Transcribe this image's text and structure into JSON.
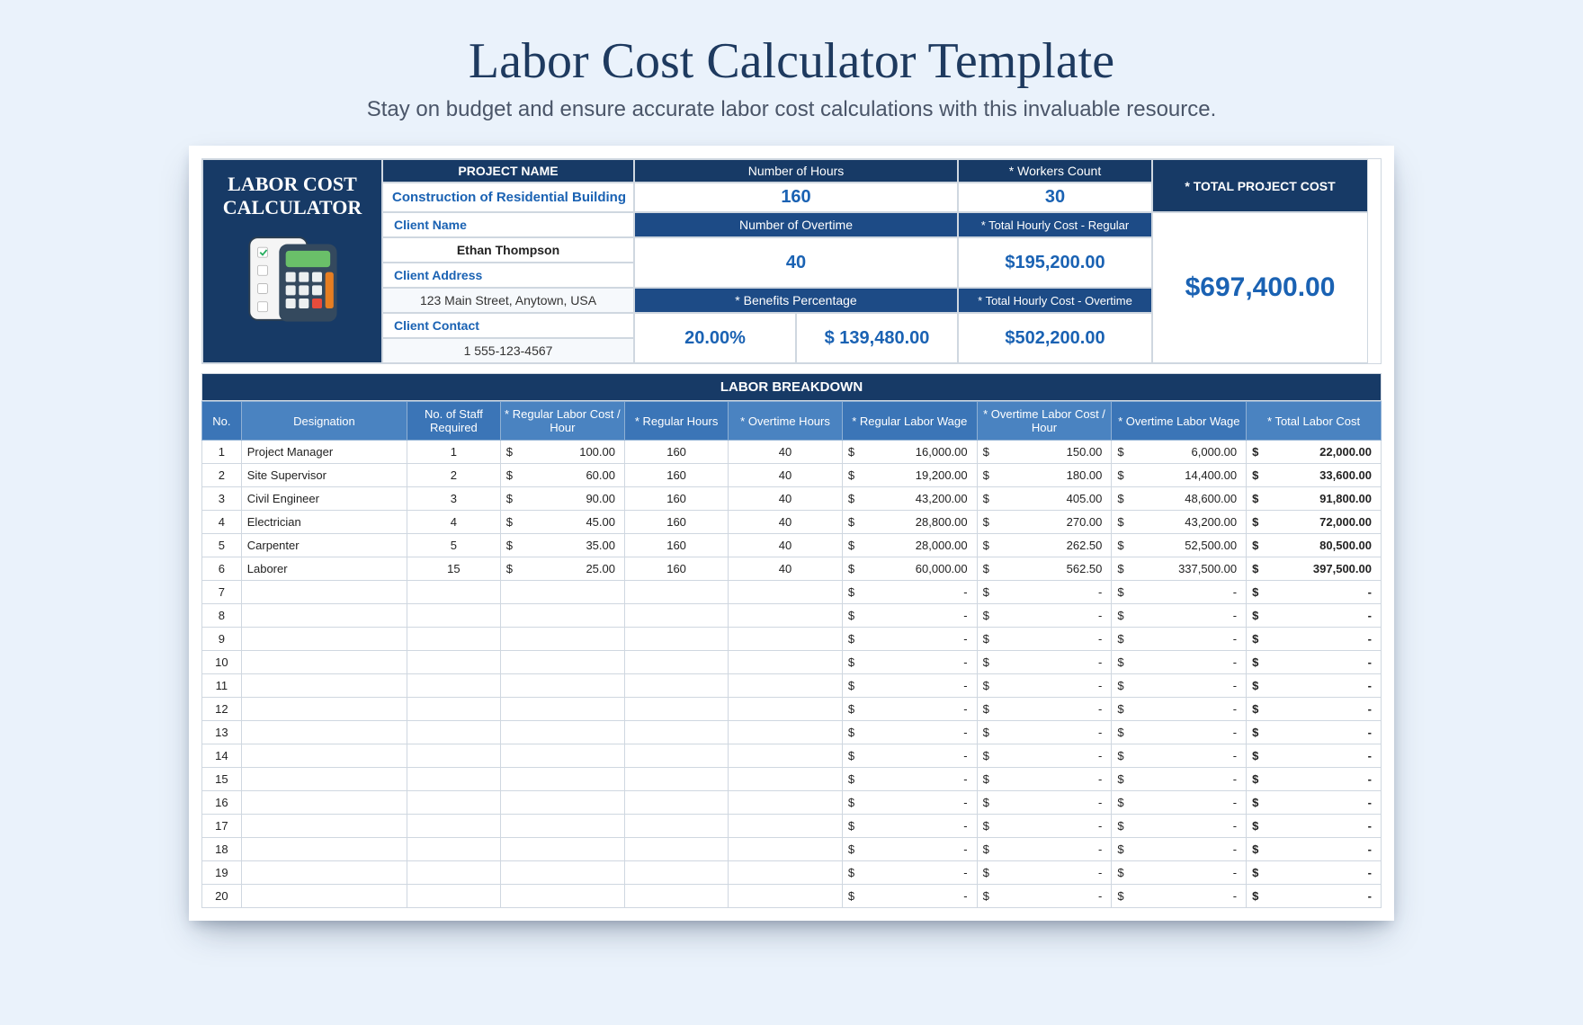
{
  "page": {
    "title": "Labor Cost Calculator Template",
    "subtitle": "Stay on budget and ensure accurate labor cost calculations with this invaluable resource."
  },
  "calc_title_line1": "LABOR COST",
  "calc_title_line2": "CALCULATOR",
  "top": {
    "project_name_label": "PROJECT NAME",
    "project_name_value": "Construction of Residential Building",
    "hours_label": "Number of Hours",
    "hours_value": "160",
    "workers_label": "* Workers Count",
    "workers_value": "30",
    "total_label": "* TOTAL PROJECT COST",
    "total_value": "$697,400.00",
    "client_name_label": "Client Name",
    "client_name_value": "Ethan Thompson",
    "overtime_label": "Number of Overtime",
    "overtime_value": "40",
    "reg_hourly_label": "* Total Hourly Cost - Regular",
    "reg_hourly_value": "$195,200.00",
    "client_addr_label": "Client Address",
    "client_addr_value": "123 Main Street, Anytown, USA",
    "benefits_label": "* Benefits Percentage",
    "benefits_pct": "20.00%",
    "benefits_amt": "$ 139,480.00",
    "ot_hourly_label": "* Total Hourly Cost - Overtime",
    "ot_hourly_value": "$502,200.00",
    "client_contact_label": "Client Contact",
    "client_contact_value": "1 555-123-4567"
  },
  "breakdown_title": "LABOR BREAKDOWN",
  "columns": {
    "no": "No.",
    "designation": "Designation",
    "staff": "No. of Staff Required",
    "rate": "* Regular Labor Cost / Hour",
    "reg_hours": "* Regular Hours",
    "ot_hours": "* Overtime Hours",
    "reg_wage": "* Regular Labor Wage",
    "ot_rate": "* Overtime Labor Cost / Hour",
    "ot_wage": "* Overtime Labor Wage",
    "total": "* Total Labor Cost"
  },
  "rows": [
    {
      "no": 1,
      "designation": "Project Manager",
      "staff": "1",
      "rate": "100.00",
      "rh": "160",
      "oh": "40",
      "rw": "16,000.00",
      "or": "150.00",
      "ow": "6,000.00",
      "tot": "22,000.00"
    },
    {
      "no": 2,
      "designation": "Site Supervisor",
      "staff": "2",
      "rate": "60.00",
      "rh": "160",
      "oh": "40",
      "rw": "19,200.00",
      "or": "180.00",
      "ow": "14,400.00",
      "tot": "33,600.00"
    },
    {
      "no": 3,
      "designation": "Civil Engineer",
      "staff": "3",
      "rate": "90.00",
      "rh": "160",
      "oh": "40",
      "rw": "43,200.00",
      "or": "405.00",
      "ow": "48,600.00",
      "tot": "91,800.00"
    },
    {
      "no": 4,
      "designation": "Electrician",
      "staff": "4",
      "rate": "45.00",
      "rh": "160",
      "oh": "40",
      "rw": "28,800.00",
      "or": "270.00",
      "ow": "43,200.00",
      "tot": "72,000.00"
    },
    {
      "no": 5,
      "designation": "Carpenter",
      "staff": "5",
      "rate": "35.00",
      "rh": "160",
      "oh": "40",
      "rw": "28,000.00",
      "or": "262.50",
      "ow": "52,500.00",
      "tot": "80,500.00"
    },
    {
      "no": 6,
      "designation": "Laborer",
      "staff": "15",
      "rate": "25.00",
      "rh": "160",
      "oh": "40",
      "rw": "60,000.00",
      "or": "562.50",
      "ow": "337,500.00",
      "tot": "397,500.00"
    },
    {
      "no": 7,
      "designation": "",
      "staff": "",
      "rate": "",
      "rh": "",
      "oh": "",
      "rw": "-",
      "or": "-",
      "ow": "-",
      "tot": "-"
    },
    {
      "no": 8,
      "designation": "",
      "staff": "",
      "rate": "",
      "rh": "",
      "oh": "",
      "rw": "-",
      "or": "-",
      "ow": "-",
      "tot": "-"
    },
    {
      "no": 9,
      "designation": "",
      "staff": "",
      "rate": "",
      "rh": "",
      "oh": "",
      "rw": "-",
      "or": "-",
      "ow": "-",
      "tot": "-"
    },
    {
      "no": 10,
      "designation": "",
      "staff": "",
      "rate": "",
      "rh": "",
      "oh": "",
      "rw": "-",
      "or": "-",
      "ow": "-",
      "tot": "-"
    },
    {
      "no": 11,
      "designation": "",
      "staff": "",
      "rate": "",
      "rh": "",
      "oh": "",
      "rw": "-",
      "or": "-",
      "ow": "-",
      "tot": "-"
    },
    {
      "no": 12,
      "designation": "",
      "staff": "",
      "rate": "",
      "rh": "",
      "oh": "",
      "rw": "-",
      "or": "-",
      "ow": "-",
      "tot": "-"
    },
    {
      "no": 13,
      "designation": "",
      "staff": "",
      "rate": "",
      "rh": "",
      "oh": "",
      "rw": "-",
      "or": "-",
      "ow": "-",
      "tot": "-"
    },
    {
      "no": 14,
      "designation": "",
      "staff": "",
      "rate": "",
      "rh": "",
      "oh": "",
      "rw": "-",
      "or": "-",
      "ow": "-",
      "tot": "-"
    },
    {
      "no": 15,
      "designation": "",
      "staff": "",
      "rate": "",
      "rh": "",
      "oh": "",
      "rw": "-",
      "or": "-",
      "ow": "-",
      "tot": "-"
    },
    {
      "no": 16,
      "designation": "",
      "staff": "",
      "rate": "",
      "rh": "",
      "oh": "",
      "rw": "-",
      "or": "-",
      "ow": "-",
      "tot": "-"
    },
    {
      "no": 17,
      "designation": "",
      "staff": "",
      "rate": "",
      "rh": "",
      "oh": "",
      "rw": "-",
      "or": "-",
      "ow": "-",
      "tot": "-"
    },
    {
      "no": 18,
      "designation": "",
      "staff": "",
      "rate": "",
      "rh": "",
      "oh": "",
      "rw": "-",
      "or": "-",
      "ow": "-",
      "tot": "-"
    },
    {
      "no": 19,
      "designation": "",
      "staff": "",
      "rate": "",
      "rh": "",
      "oh": "",
      "rw": "-",
      "or": "-",
      "ow": "-",
      "tot": "-"
    },
    {
      "no": 20,
      "designation": "",
      "staff": "",
      "rate": "",
      "rh": "",
      "oh": "",
      "rw": "-",
      "or": "-",
      "ow": "-",
      "tot": "-"
    }
  ]
}
